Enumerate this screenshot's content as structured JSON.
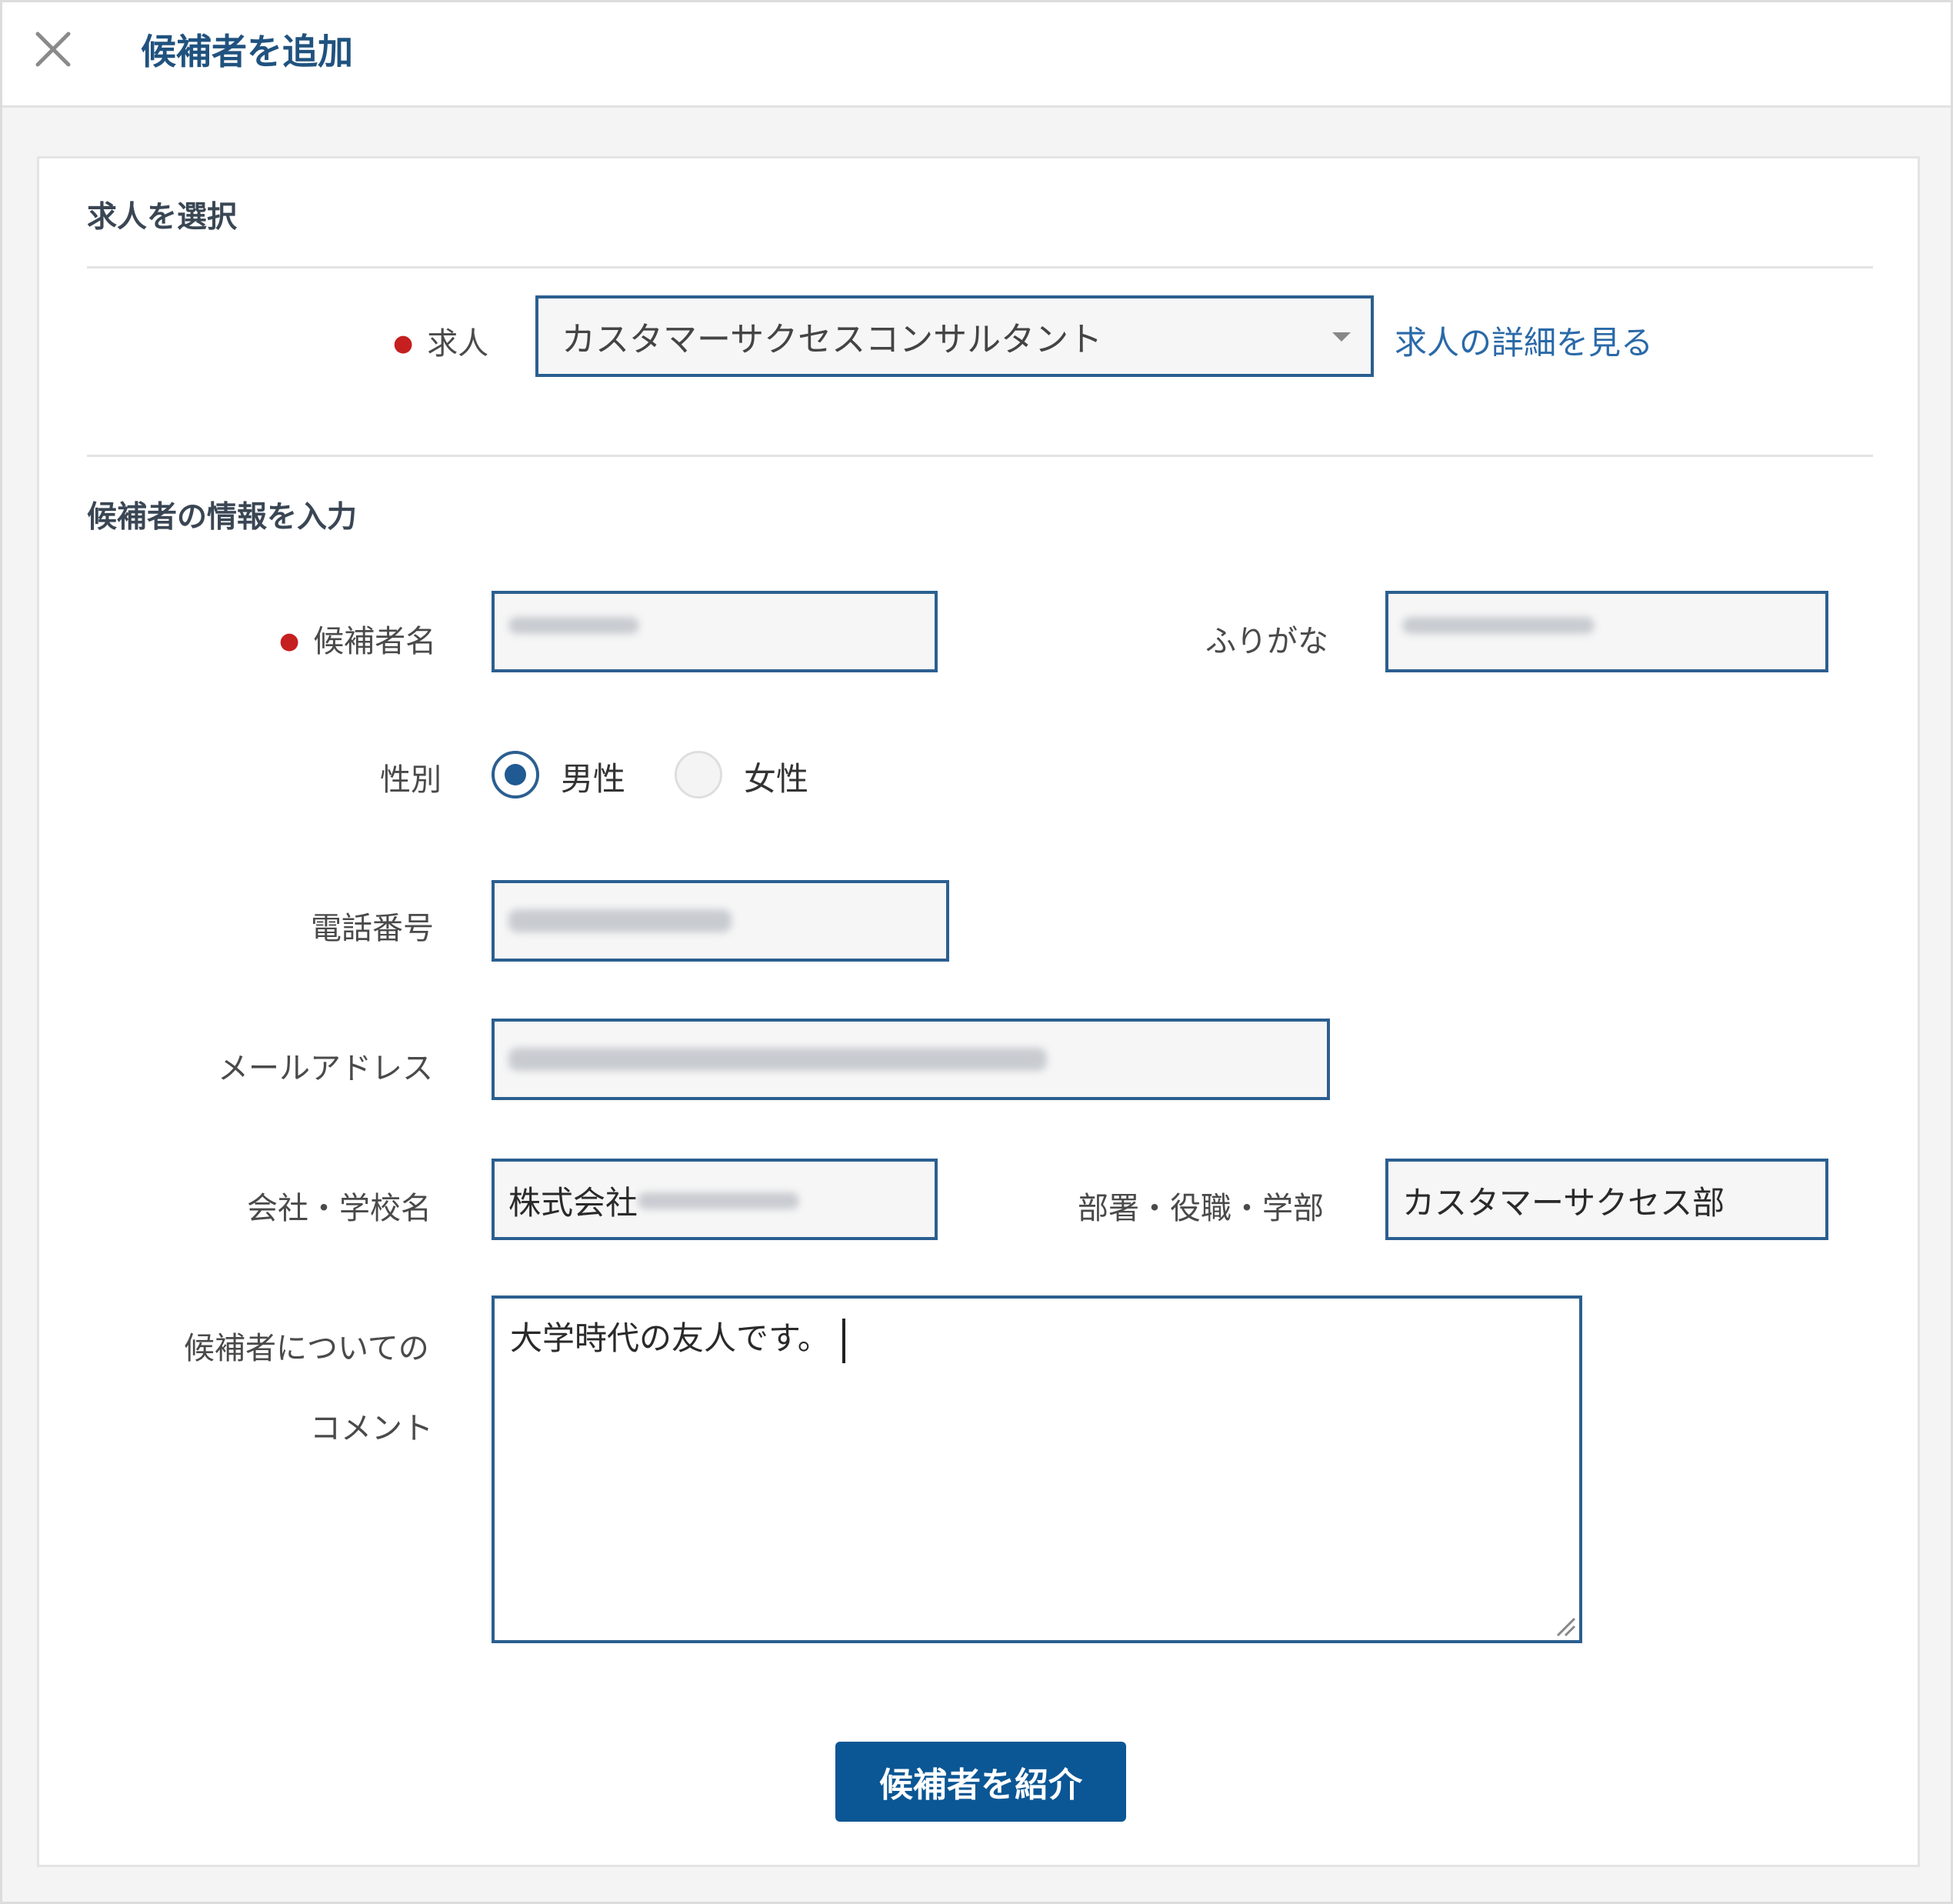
{
  "dialog": {
    "title": "候補者を追加",
    "close_icon": "close-icon"
  },
  "job_section": {
    "title": "求人を選択",
    "job_label": "求人",
    "job_selected": "カスタマーサクセスコンサルタント",
    "job_detail_link": "求人の詳細を見る",
    "dropdown_icon": "caret-down-icon"
  },
  "candidate_section": {
    "title": "候補者の情報を入力",
    "name_label": "候補者名",
    "furigana_label": "ふりがな",
    "gender_label": "性別",
    "gender_options": [
      "男性",
      "女性"
    ],
    "gender_selected": "男性",
    "phone_label": "電話番号",
    "email_label": "メールアドレス",
    "company_label": "会社・学校名",
    "company_value": "株式会社",
    "department_label": "部署・役職・学部",
    "department_value": "カスタマーサクセス部",
    "comment_label_line1": "候補者についての",
    "comment_label_line2": "コメント",
    "comment_value": "大学時代の友人です。"
  },
  "submit_label": "候補者を紹介",
  "colors": {
    "accent": "#2b5f90",
    "button": "#0b5694",
    "link": "#2a69a8",
    "required": "#c61f1f",
    "heading": "#20527f"
  }
}
